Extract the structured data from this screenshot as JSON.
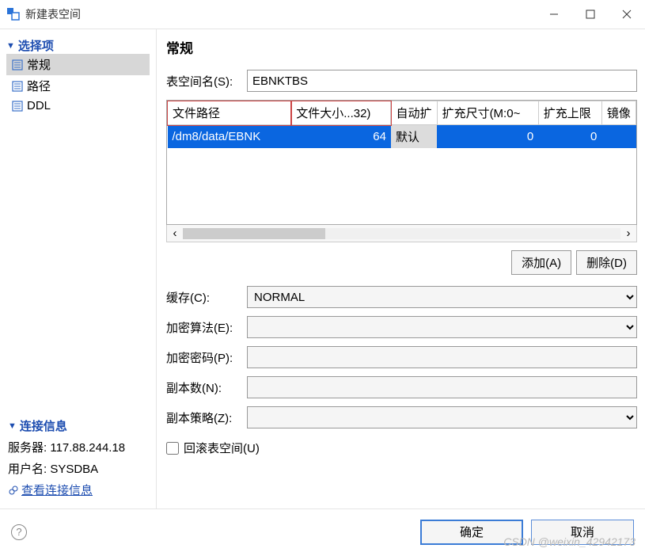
{
  "window": {
    "title": "新建表空间"
  },
  "sidebar": {
    "section1_title": "选择项",
    "items": [
      {
        "label": "常规"
      },
      {
        "label": "路径"
      },
      {
        "label": "DDL"
      }
    ],
    "section2_title": "连接信息",
    "server_label": "服务器: 117.88.244.18",
    "user_label": "用户名: SYSDBA",
    "view_conn_label": "查看连接信息"
  },
  "content": {
    "heading": "常规",
    "ts_name_label": "表空间名(S):",
    "ts_name_value": "EBNKTBS",
    "columns": {
      "path": "文件路径",
      "size": "文件大小...32)",
      "auto": "自动扩",
      "inc": "扩充尺寸(M:0~",
      "max": "扩充上限",
      "mirror": "镜像"
    },
    "row": {
      "path": "/dm8/data/EBNK",
      "size": "64",
      "auto": "默认",
      "inc": "0",
      "max": "0"
    },
    "btn_add": "添加(A)",
    "btn_del": "删除(D)",
    "cache_label": "缓存(C):",
    "cache_value": "NORMAL",
    "enc_alg_label": "加密算法(E):",
    "enc_pwd_label": "加密密码(P):",
    "copy_num_label": "副本数(N):",
    "copy_pol_label": "副本策略(Z):",
    "rollback_label": "回滚表空间(U)"
  },
  "footer": {
    "ok": "确定",
    "cancel": "取消"
  },
  "watermark": "CSDN @weixin_42942173"
}
